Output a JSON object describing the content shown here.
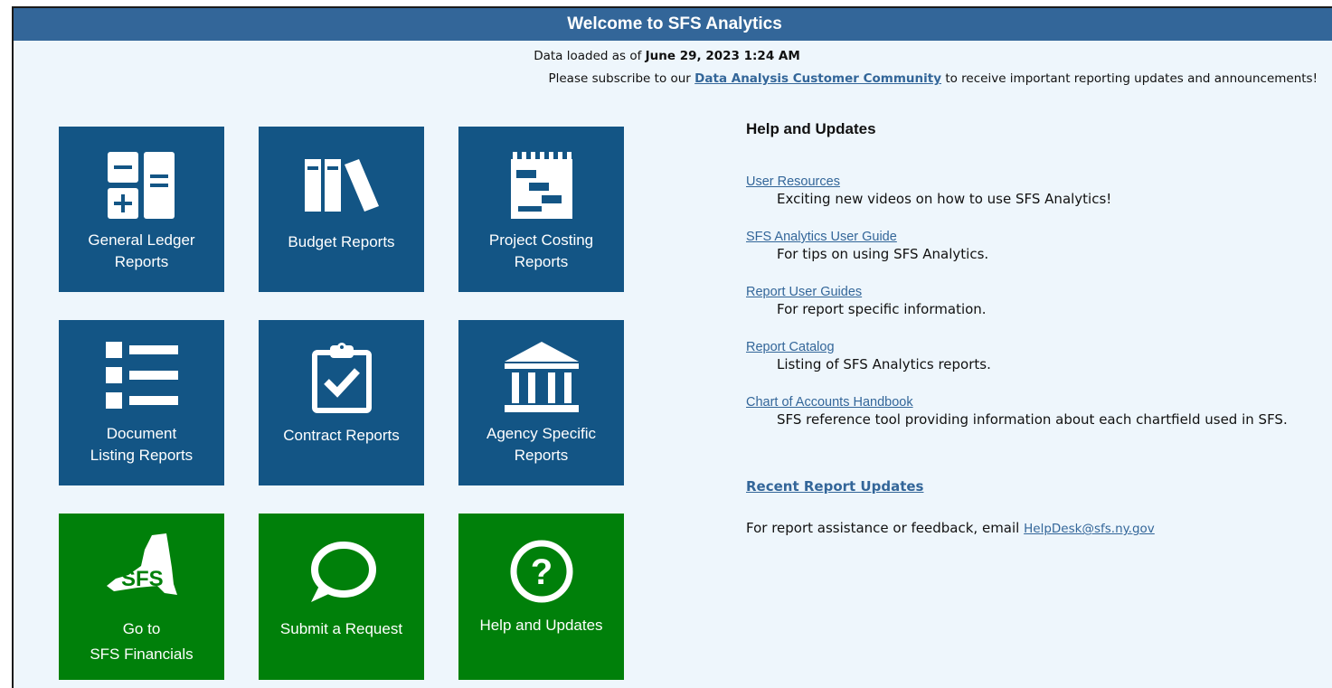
{
  "header": {
    "title": "Welcome to SFS Analytics"
  },
  "data_loaded": {
    "prefix": "Data loaded as of",
    "date": "June 29, 2023 1:24 AM"
  },
  "subscribe": {
    "before": "Please subscribe to our",
    "link": "Data Analysis Customer Community",
    "after": "to receive important reporting updates and announcements!"
  },
  "tiles": [
    {
      "line1": "General Ledger",
      "line2": "Reports",
      "icon": "calculator-icon",
      "color": "#135585"
    },
    {
      "line1": "Budget Reports",
      "line2": "",
      "icon": "books-icon",
      "color": "#135585"
    },
    {
      "line1": "Project Costing",
      "line2": "Reports",
      "icon": "gantt-notepad-icon",
      "color": "#135585"
    },
    {
      "line1": "Document",
      "line2": "Listing Reports",
      "icon": "list-icon",
      "color": "#135585"
    },
    {
      "line1": "Contract Reports",
      "line2": "",
      "icon": "clipboard-check-icon",
      "color": "#135585"
    },
    {
      "line1": "Agency Specific",
      "line2": "Reports",
      "icon": "building-columns-icon",
      "color": "#135585"
    },
    {
      "line1": "Go to",
      "line2": "SFS Financials",
      "icon": "sfs-ny-logo-icon",
      "color": "#00800a"
    },
    {
      "line1": "Submit a Request",
      "line2": "",
      "icon": "speech-bubble-icon",
      "color": "#00800a"
    },
    {
      "line1": "Help and Updates",
      "line2": "",
      "icon": "question-circle-icon",
      "color": "#00800a"
    }
  ],
  "help": {
    "title": "Help and Updates",
    "items": [
      {
        "link": "User Resources",
        "desc": "Exciting new videos on how to use SFS Analytics!"
      },
      {
        "link": "SFS Analytics User Guide",
        "desc": "For tips on using SFS Analytics."
      },
      {
        "link": "Report User Guides",
        "desc": "For report specific information."
      },
      {
        "link": "Report Catalog",
        "desc": "Listing of SFS Analytics reports."
      },
      {
        "link": "Chart of Accounts Handbook",
        "desc": "SFS reference tool providing information about each chartfield used in SFS."
      }
    ],
    "recent": "Recent Report Updates",
    "assist_text": "For report assistance or feedback, email",
    "assist_email": "HelpDesk@sfs.ny.gov"
  },
  "colors": {
    "header": "#336699",
    "tile_blue": "#135585",
    "tile_green": "#00800a",
    "background": "#eef6fc",
    "link": "#336699"
  }
}
